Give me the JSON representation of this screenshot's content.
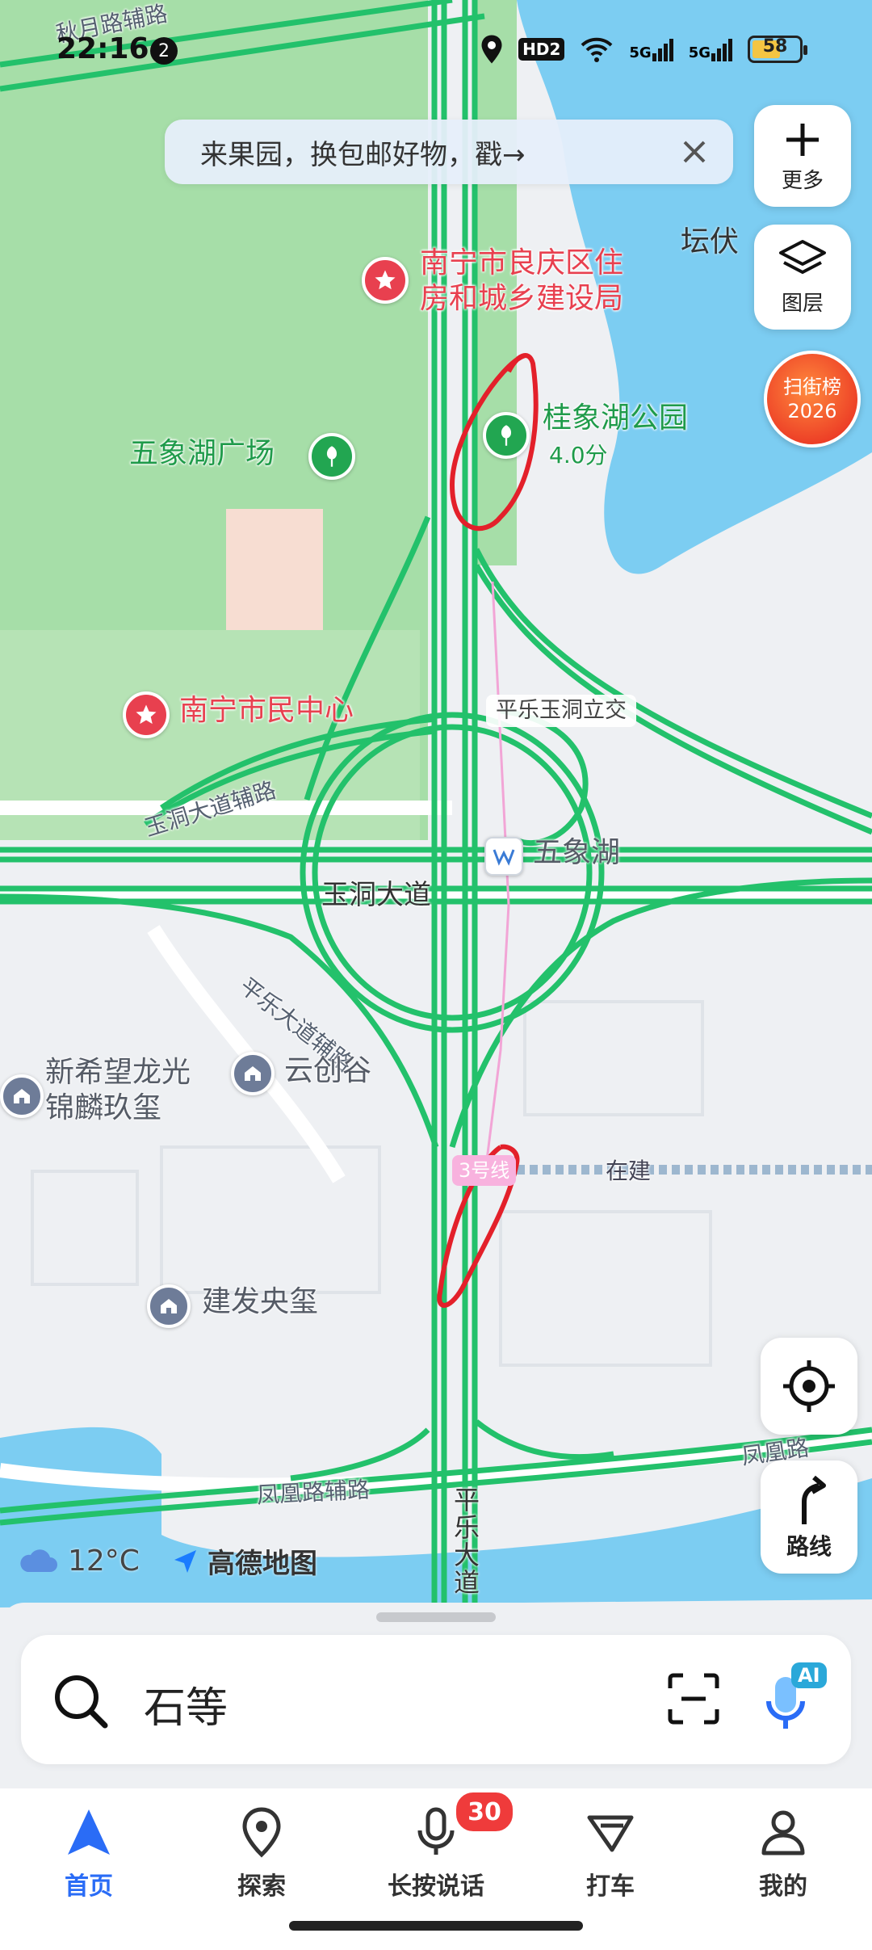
{
  "status": {
    "time": "22:16",
    "notification_count": "2",
    "battery": "58",
    "network": [
      "HD2",
      "5G",
      "5G"
    ]
  },
  "banner": {
    "text": "来果园，换包邮好物，戳→"
  },
  "controls": {
    "more": "更多",
    "layers": "图层",
    "scan_line1": "扫街榜",
    "scan_line2": "2026",
    "route": "路线"
  },
  "map": {
    "poi": {
      "housing_bureau_line1": "南宁市良庆区住",
      "housing_bureau_line2": "房和城乡建设局",
      "guixiang_park": "桂象湖公园",
      "guixiang_rating": "4.0分",
      "wuxiang_square": "五象湖广场",
      "citizen_center": "南宁市民中心",
      "interchange": "平乐玉洞立交",
      "metro_station": "五象湖",
      "xinxiwang_line1": "新希望龙光",
      "xinxiwang_line2": "锦麟玖玺",
      "yunchuanggu": "云创谷",
      "jianfa": "建发央玺",
      "tanfu": "坛伏",
      "line3": "3号线",
      "under_construction": "在建"
    },
    "roads": {
      "qiuyue_aux": "秋月路辅路",
      "yudong_aux": "玉洞大道辅路",
      "yudong": "玉洞大道",
      "pingle_aux": "平乐大道辅路",
      "fenghuang_aux": "凤凰路辅路",
      "fenghuang": "凤凰路",
      "pingle_1": "平",
      "pingle_2": "乐",
      "pingle_3": "大",
      "pingle_4": "道"
    }
  },
  "weather": {
    "temp": "12°C",
    "brand": "高德地图"
  },
  "search": {
    "query": "石等",
    "ai": "AI"
  },
  "tabs": [
    {
      "label": "首页",
      "icon": "navigation-arrow-icon"
    },
    {
      "label": "探索",
      "icon": "location-pin-icon"
    },
    {
      "label": "长按说话",
      "icon": "microphone-icon"
    },
    {
      "label": "打车",
      "icon": "taxi-icon"
    },
    {
      "label": "我的",
      "icon": "person-icon"
    }
  ],
  "voice_badge": "30",
  "colors": {
    "accent": "#2a6cf6",
    "road_green": "#23c16b",
    "water": "#7ccdf2",
    "park": "#a6dea8",
    "annotation_red": "#e3202a"
  }
}
